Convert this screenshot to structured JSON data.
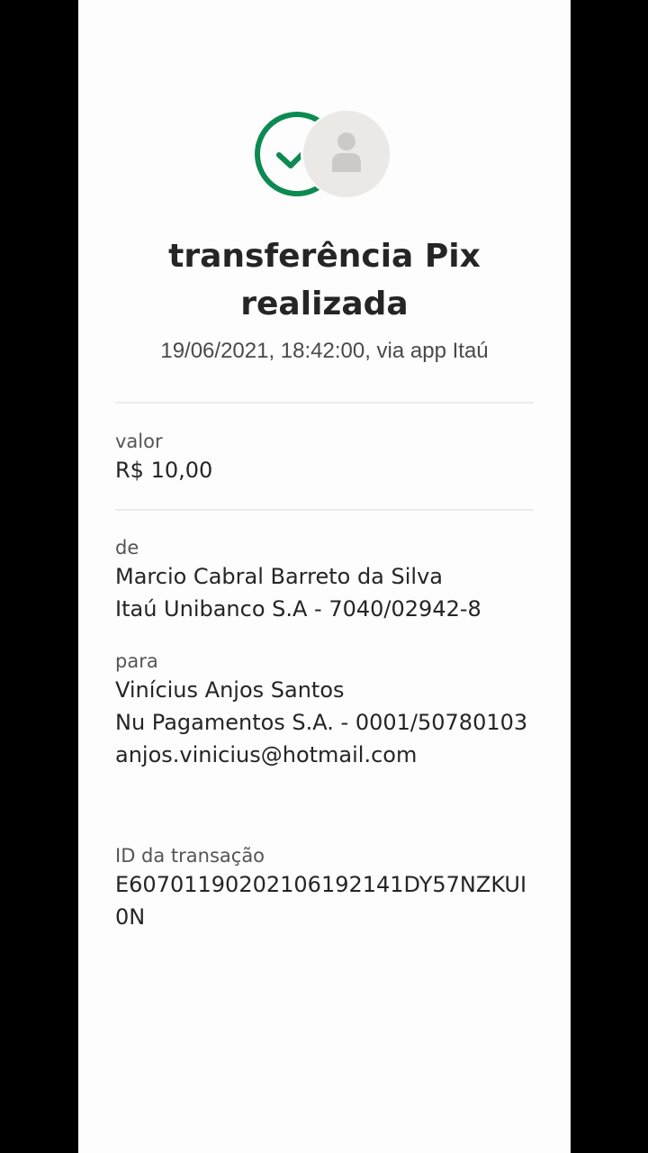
{
  "header": {
    "title_line1": "transferência Pix",
    "title_line2": "realizada",
    "subtitle": "19/06/2021,  18:42:00, via app Itaú"
  },
  "valor": {
    "label": "valor",
    "amount": "R$ 10,00"
  },
  "de": {
    "label": "de",
    "name": "Marcio Cabral Barreto da Silva",
    "bank": "Itaú Unibanco S.A - 7040/02942-8"
  },
  "para": {
    "label": "para",
    "name": "Vinícius Anjos Santos",
    "bank": "Nu Pagamentos S.A. - 0001/50780103",
    "email": "anjos.vinicius@hotmail.com"
  },
  "transacao": {
    "label": "ID da transação",
    "id": "E60701190202106192141DY57NZKUI0N"
  },
  "icons": {
    "success": "check-circle-icon",
    "avatar": "person-icon"
  },
  "colors": {
    "success": "#0c8a52",
    "avatar_bg": "#ebe8e6",
    "avatar_fg": "#cdc9c6"
  }
}
